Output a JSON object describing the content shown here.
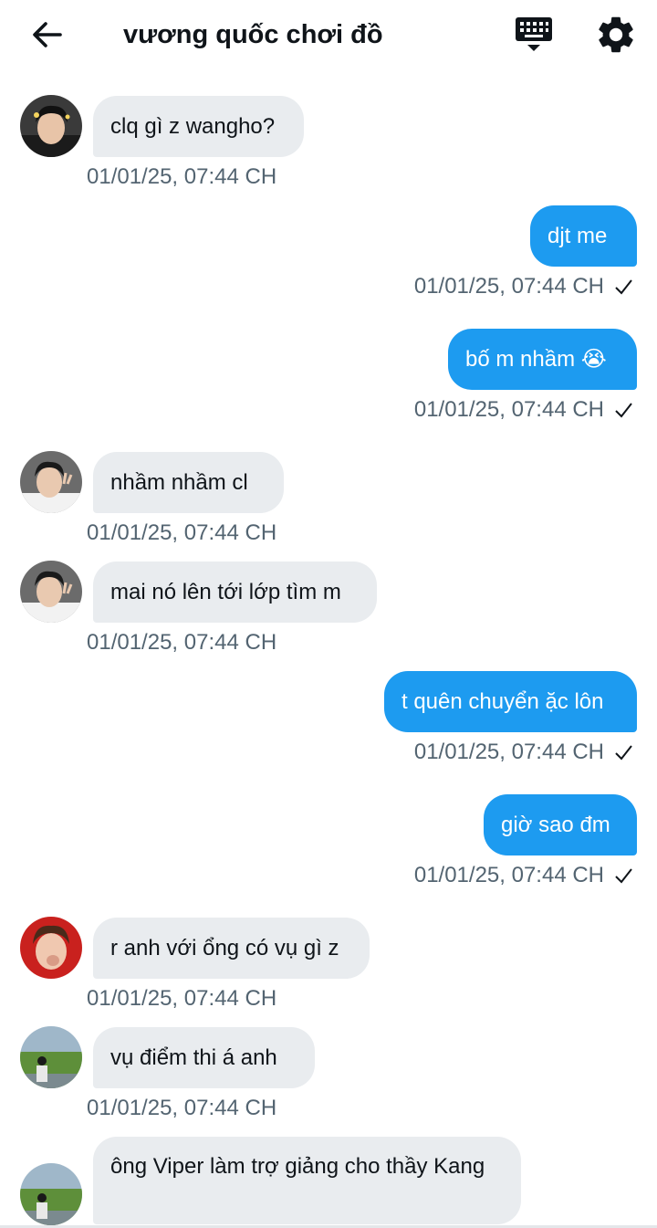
{
  "header": {
    "title": "vương quốc chơi đồ",
    "back_icon": "arrow-left-icon",
    "keyboard_icon": "keyboard-hide-icon",
    "settings_icon": "gear-icon"
  },
  "colors": {
    "outgoing": "#1d9bf0",
    "incoming": "#e9ecef",
    "timestamp": "#536471"
  },
  "messages": [
    {
      "direction": "in",
      "text": "clq gì z wangho?",
      "time": "01/01/25, 07:44 CH",
      "avatar": "avatar-1"
    },
    {
      "direction": "out",
      "text": "djt me",
      "time": "01/01/25, 07:44 CH"
    },
    {
      "direction": "out",
      "text": "bố m nhầm 😭",
      "time": "01/01/25, 07:44 CH"
    },
    {
      "direction": "in",
      "text": "nhầm nhầm cl",
      "time": "01/01/25, 07:44 CH",
      "avatar": "avatar-2"
    },
    {
      "direction": "in",
      "text": "mai nó lên tới lớp tìm m",
      "time": "01/01/25, 07:44 CH",
      "avatar": "avatar-2"
    },
    {
      "direction": "out",
      "text": "t quên chuyển ặc lôn",
      "time": "01/01/25, 07:44 CH"
    },
    {
      "direction": "out",
      "text": "giờ sao đm",
      "time": "01/01/25, 07:44 CH"
    },
    {
      "direction": "in",
      "text": "r anh với ổng có vụ gì z",
      "time": "01/01/25, 07:44 CH",
      "avatar": "avatar-3"
    },
    {
      "direction": "in",
      "text": "vụ điểm thi á anh",
      "time": "01/01/25, 07:44 CH",
      "avatar": "avatar-4"
    },
    {
      "direction": "in",
      "text": "ông Viper làm trợ giảng cho thầy Kang",
      "time": "",
      "avatar": "avatar-4"
    }
  ]
}
